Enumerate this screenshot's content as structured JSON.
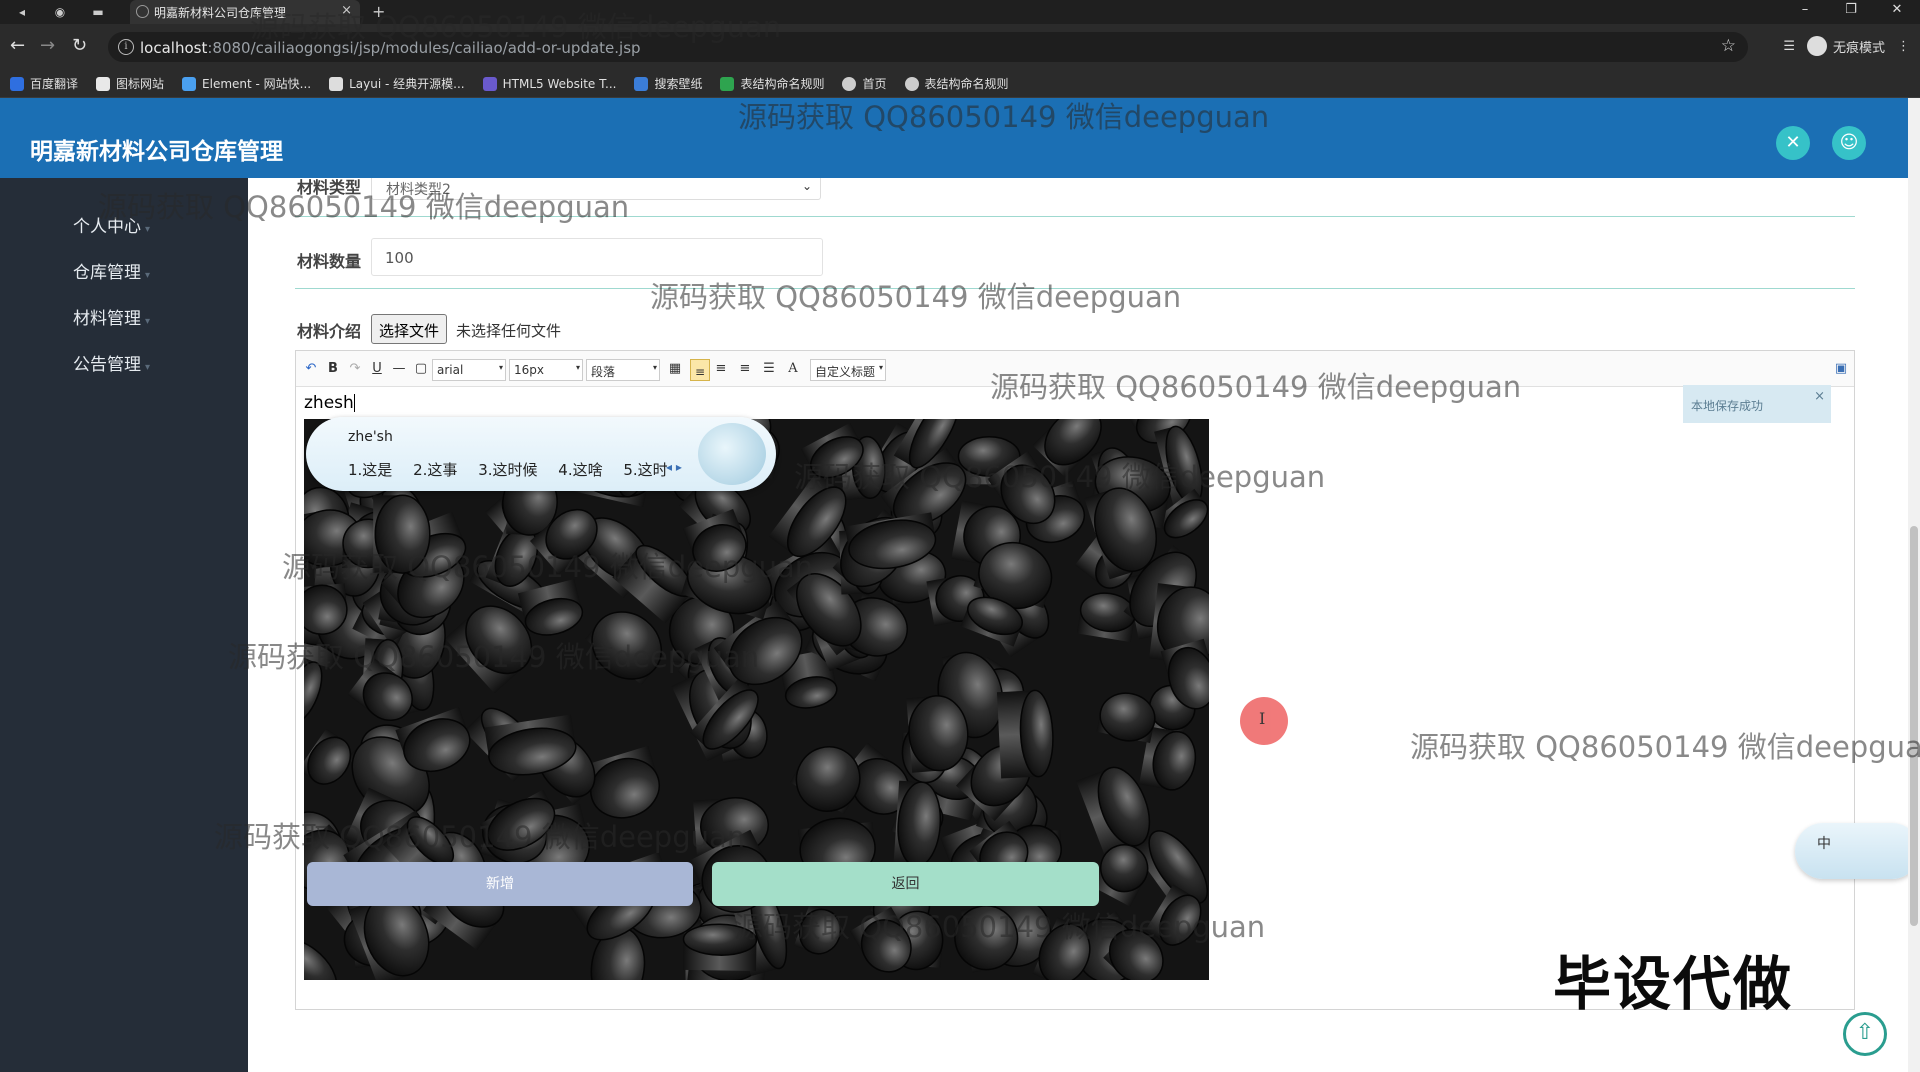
{
  "browser": {
    "tab_title": "明嘉新材料公司仓库管理",
    "url_host": "localhost",
    "url_path": ":8080/cailiaogongsi/jsp/modules/cailiao/add-or-update.jsp",
    "profile_label": "无痕模式",
    "bookmarks": [
      {
        "label": "百度翻译",
        "color": "#2f6fe0"
      },
      {
        "label": "图标网站",
        "color": "#e8e8e8"
      },
      {
        "label": "Element - 网站快...",
        "color": "#4aa0f0"
      },
      {
        "label": "Layui - 经典开源模...",
        "color": "#dddddd"
      },
      {
        "label": "HTML5 Website T...",
        "color": "#6a5acd"
      },
      {
        "label": "搜索壁纸",
        "color": "#3b7dd8"
      },
      {
        "label": "表结构命名规则",
        "color": "#2ea44f"
      },
      {
        "label": "首页",
        "color": "#cccccc"
      },
      {
        "label": "表结构命名规则",
        "color": "#cccccc"
      }
    ]
  },
  "app": {
    "title": "明嘉新材料公司仓库管理"
  },
  "sidebar": {
    "items": [
      {
        "label": "个人中心"
      },
      {
        "label": "仓库管理"
      },
      {
        "label": "材料管理"
      },
      {
        "label": "公告管理"
      }
    ]
  },
  "form": {
    "type_label": "材料类型",
    "type_value": "材料类型2",
    "qty_label": "材料数量",
    "qty_value": "100",
    "intro_label": "材料介绍",
    "file_button": "选择文件",
    "file_status": "未选择任何文件",
    "editor": {
      "font": "arial",
      "size": "16px",
      "paragraph": "段落",
      "custom_title": "自定义标题",
      "content": "zhesh",
      "toast": "本地保存成功"
    },
    "submit_label": "新增",
    "back_label": "返回"
  },
  "ime": {
    "pinyin": "zhe'sh",
    "candidates": [
      "1.这是",
      "2.这事",
      "3.这时候",
      "4.这啥",
      "5.这时"
    ],
    "mini_label": "中"
  },
  "overlay": {
    "watermark": "源码获取 QQ86050149 微信deepguan",
    "stamp": "毕设代做"
  },
  "colors": {
    "header": "#1b6fb4",
    "sidebar": "#252d38",
    "accent_teal": "#36c2c8",
    "submit_btn": "#a9b7d6",
    "back_btn": "#a4dfc9"
  }
}
